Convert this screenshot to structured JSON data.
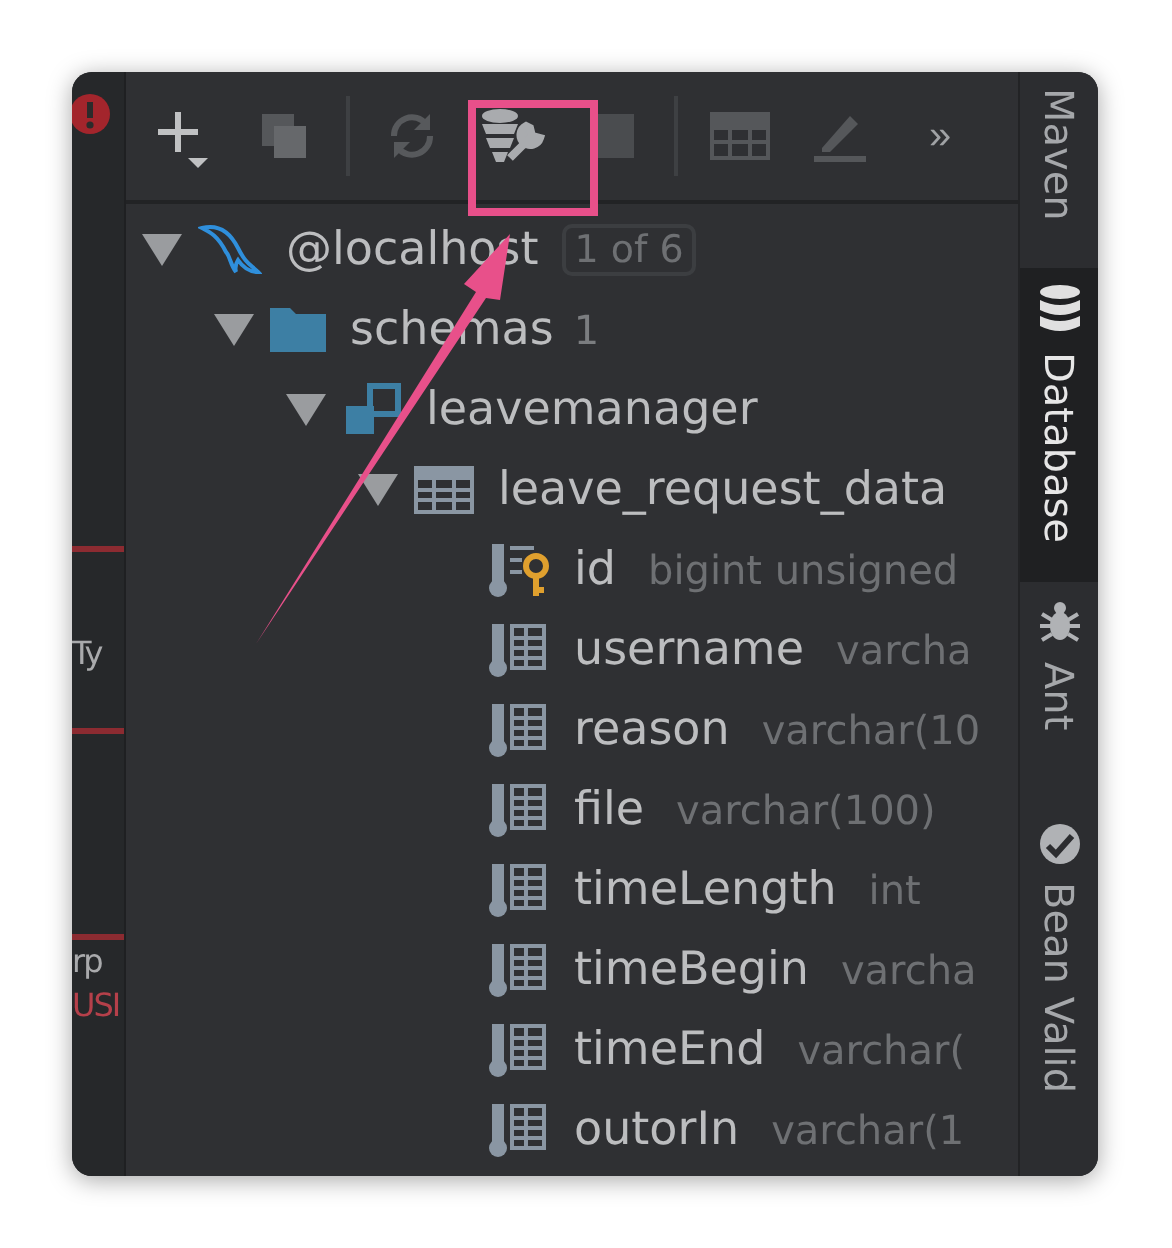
{
  "editor_strip": [
    {
      "text": "Ty",
      "kind": "plain"
    },
    {
      "text": "rp",
      "kind": "plain"
    },
    {
      "text": "USI",
      "kind": "error"
    }
  ],
  "toolbar": [
    {
      "kind": "add"
    },
    {
      "kind": "copy"
    },
    {
      "kind": "sep"
    },
    {
      "kind": "refresh"
    },
    {
      "kind": "db-tools",
      "highlighted": true
    },
    {
      "kind": "stop"
    },
    {
      "kind": "sep"
    },
    {
      "kind": "table"
    },
    {
      "kind": "edit"
    },
    {
      "kind": "more",
      "text": "»"
    }
  ],
  "tree": [
    {
      "kind": "connection",
      "label": "@localhost",
      "badge": "1 of 6",
      "expanded": true,
      "children": [
        {
          "kind": "folder",
          "label": "schemas",
          "count": "1",
          "expanded": true,
          "children": [
            {
              "kind": "schema",
              "label": "leavemanager",
              "expanded": true,
              "children": [
                {
                  "kind": "table",
                  "label": "leave_request_data",
                  "expanded": true,
                  "children": [
                    {
                      "kind": "key_column",
                      "label": "id",
                      "detail": "bigint unsigned"
                    },
                    {
                      "kind": "column",
                      "label": "username",
                      "detail": "varcha"
                    },
                    {
                      "kind": "column",
                      "label": "reason",
                      "detail": "varchar(10"
                    },
                    {
                      "kind": "column",
                      "label": "file",
                      "detail": "varchar(100)"
                    },
                    {
                      "kind": "column",
                      "label": "timeLength",
                      "detail": "int"
                    },
                    {
                      "kind": "column",
                      "label": "timeBegin",
                      "detail": "varcha"
                    },
                    {
                      "kind": "column",
                      "label": "timeEnd",
                      "detail": "varchar("
                    },
                    {
                      "kind": "column",
                      "label": "outorIn",
                      "detail": "varchar(1"
                    }
                  ]
                }
              ]
            }
          ]
        }
      ]
    }
  ],
  "side_tabs": [
    {
      "label": "Maven",
      "kind": "plain",
      "selected": false
    },
    {
      "label": "Database",
      "kind": "database",
      "selected": true
    },
    {
      "label": "Ant",
      "kind": "ant",
      "selected": false
    },
    {
      "label": "Bean Valid",
      "kind": "bean",
      "selected": false
    }
  ]
}
